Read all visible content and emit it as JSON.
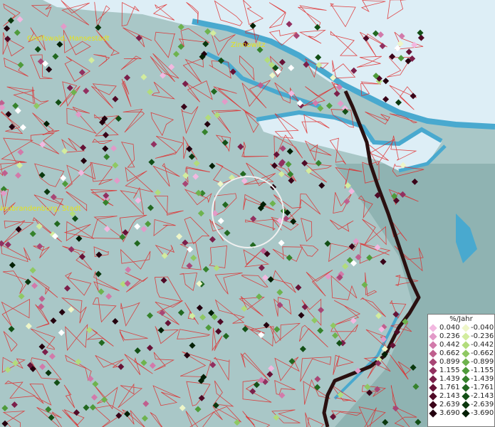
{
  "places": [
    {
      "name": "Greifswald, Hansestadt",
      "id": "greifswald"
    },
    {
      "name": "Zinnowitz",
      "id": "zinnowitz"
    },
    {
      "name": "Neubrandenburg, Stadt",
      "id": "neubrandenburg"
    }
  ],
  "legend": {
    "title": "%/Jahr",
    "positive": [
      {
        "value": "0.040",
        "color": "#f2b8e0"
      },
      {
        "value": "0.236",
        "color": "#e29ac8"
      },
      {
        "value": "0.442",
        "color": "#d27aaa"
      },
      {
        "value": "0.662",
        "color": "#bf5f8e"
      },
      {
        "value": "0.899",
        "color": "#a84675"
      },
      {
        "value": "1.155",
        "color": "#923060"
      },
      {
        "value": "1.439",
        "color": "#7b1f4a"
      },
      {
        "value": "1.761",
        "color": "#661236"
      },
      {
        "value": "2.143",
        "color": "#4f0a26"
      },
      {
        "value": "2.639",
        "color": "#3a0419"
      },
      {
        "value": "3.690",
        "color": "#24000e"
      }
    ],
    "negative": [
      {
        "value": "-0.040",
        "color": "#eef6c8"
      },
      {
        "value": "-0.236",
        "color": "#d2ec9e"
      },
      {
        "value": "-0.442",
        "color": "#b2dc7c"
      },
      {
        "value": "-0.662",
        "color": "#8fc863"
      },
      {
        "value": "-0.899",
        "color": "#6eb34e"
      },
      {
        "value": "-1.155",
        "color": "#4f9b3b"
      },
      {
        "value": "-1.439",
        "color": "#36822c"
      },
      {
        "value": "-1.761",
        "color": "#226820"
      },
      {
        "value": "-2.143",
        "color": "#134f16"
      },
      {
        "value": "-2.639",
        "color": "#0a370d"
      },
      {
        "value": "-3.690",
        "color": "#031f05"
      }
    ]
  },
  "colors": {
    "land": "#a9c7c7",
    "water": "#49a9cf",
    "sea_ice": "#ddeef6",
    "boundary": "#e02a2a",
    "border": "#2a1010"
  }
}
